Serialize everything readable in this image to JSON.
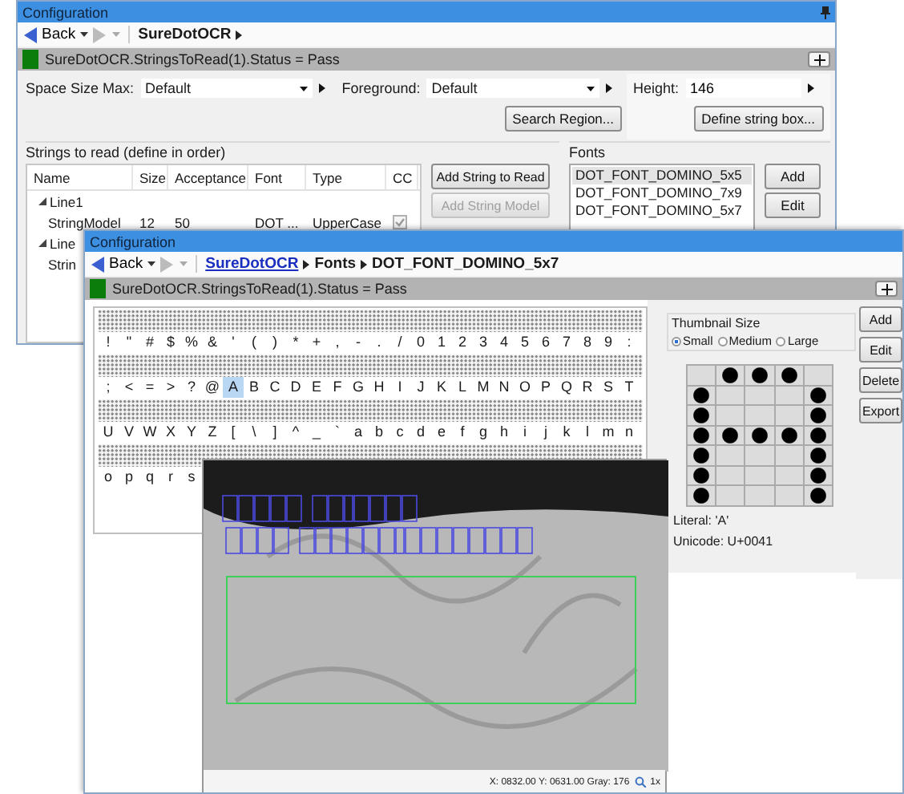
{
  "back_window": {
    "title": "Configuration",
    "nav": {
      "back": "Back",
      "crumbs": [
        {
          "label": "SureDotOCR",
          "link": false
        }
      ]
    },
    "status": {
      "text": "SureDotOCR.StringsToRead(1).Status = Pass",
      "passed": true
    },
    "fields": [
      {
        "label": "Space Size Max:",
        "value": "Default"
      },
      {
        "label": "Foreground:",
        "value": "Default"
      }
    ],
    "height": {
      "label": "Height:",
      "value": "146"
    },
    "search_button": "Search Region...",
    "define_button": "Define string box...",
    "strings_group": {
      "title": "Strings to read (define in order)",
      "columns": [
        "Name",
        "Size",
        "Acceptance",
        "Font",
        "Type",
        "CC"
      ],
      "rows": [
        {
          "name": "Line1",
          "expanded": true,
          "children": [
            {
              "name": "StringModel",
              "size": "12",
              "acceptance": "50",
              "font": "DOT ...",
              "type": "UpperCase",
              "cc": true
            }
          ]
        },
        {
          "name": "Line",
          "expanded": true,
          "children": [
            {
              "name": "Strin"
            }
          ]
        }
      ]
    },
    "string_buttons": [
      {
        "label": "Add String to Read",
        "disabled": false
      },
      {
        "label": "Add String Model",
        "disabled": true
      }
    ],
    "fonts_group": {
      "title": "Fonts",
      "items": [
        {
          "label": "DOT_FONT_DOMINO_5x5",
          "selected": true
        },
        {
          "label": "DOT_FONT_DOMINO_7x9",
          "selected": false
        },
        {
          "label": "DOT_FONT_DOMINO_5x7",
          "selected": false
        }
      ],
      "buttons": [
        "Add",
        "Edit"
      ]
    }
  },
  "front_window": {
    "title": "Configuration",
    "nav": {
      "back": "Back",
      "crumbs": [
        {
          "label": "SureDotOCR",
          "link": true
        },
        {
          "label": "Fonts",
          "link": false
        },
        {
          "label": "DOT_FONT_DOMINO_5x7",
          "link": false
        }
      ]
    },
    "status": {
      "text": "SureDotOCR.StringsToRead(1).Status = Pass",
      "passed": true
    },
    "glyph_rows": [
      [
        {
          "char": "!",
          "selected": false
        },
        {
          "char": "\"",
          "selected": false
        },
        {
          "char": "#",
          "selected": false
        },
        {
          "char": "$",
          "selected": false
        },
        {
          "char": "%",
          "selected": false
        },
        {
          "char": "&",
          "selected": false
        },
        {
          "char": "'",
          "selected": false
        },
        {
          "char": "(",
          "selected": false
        },
        {
          "char": ")",
          "selected": false
        },
        {
          "char": "*",
          "selected": false
        },
        {
          "char": "+",
          "selected": false
        },
        {
          "char": ",",
          "selected": false
        },
        {
          "char": "-",
          "selected": false
        },
        {
          "char": ".",
          "selected": false
        },
        {
          "char": "/",
          "selected": false
        },
        {
          "char": "0",
          "selected": false
        },
        {
          "char": "1",
          "selected": false
        },
        {
          "char": "2",
          "selected": false
        },
        {
          "char": "3",
          "selected": false
        },
        {
          "char": "4",
          "selected": false
        },
        {
          "char": "5",
          "selected": false
        },
        {
          "char": "6",
          "selected": false
        },
        {
          "char": "7",
          "selected": false
        },
        {
          "char": "8",
          "selected": false
        },
        {
          "char": "9",
          "selected": false
        },
        {
          "char": ":",
          "selected": false
        }
      ],
      [
        {
          "char": ";",
          "selected": false
        },
        {
          "char": "<",
          "selected": false
        },
        {
          "char": "=",
          "selected": false
        },
        {
          "char": ">",
          "selected": false
        },
        {
          "char": "?",
          "selected": false
        },
        {
          "char": "@",
          "selected": false
        },
        {
          "char": "A",
          "selected": true
        },
        {
          "char": "B",
          "selected": false
        },
        {
          "char": "C",
          "selected": false
        },
        {
          "char": "D",
          "selected": false
        },
        {
          "char": "E",
          "selected": false
        },
        {
          "char": "F",
          "selected": false
        },
        {
          "char": "G",
          "selected": false
        },
        {
          "char": "H",
          "selected": false
        },
        {
          "char": "I",
          "selected": false
        },
        {
          "char": "J",
          "selected": false
        },
        {
          "char": "K",
          "selected": false
        },
        {
          "char": "L",
          "selected": false
        },
        {
          "char": "M",
          "selected": false
        },
        {
          "char": "N",
          "selected": false
        },
        {
          "char": "O",
          "selected": false
        },
        {
          "char": "P",
          "selected": false
        },
        {
          "char": "Q",
          "selected": false
        },
        {
          "char": "R",
          "selected": false
        },
        {
          "char": "S",
          "selected": false
        },
        {
          "char": "T",
          "selected": false
        }
      ],
      [
        {
          "char": "U",
          "selected": false
        },
        {
          "char": "V",
          "selected": false
        },
        {
          "char": "W",
          "selected": false
        },
        {
          "char": "X",
          "selected": false
        },
        {
          "char": "Y",
          "selected": false
        },
        {
          "char": "Z",
          "selected": false
        },
        {
          "char": "[",
          "selected": false
        },
        {
          "char": "\\",
          "selected": false
        },
        {
          "char": "]",
          "selected": false
        },
        {
          "char": "^",
          "selected": false
        },
        {
          "char": "_",
          "selected": false
        },
        {
          "char": "`",
          "selected": false
        },
        {
          "char": "a",
          "selected": false
        },
        {
          "char": "b",
          "selected": false
        },
        {
          "char": "c",
          "selected": false
        },
        {
          "char": "d",
          "selected": false
        },
        {
          "char": "e",
          "selected": false
        },
        {
          "char": "f",
          "selected": false
        },
        {
          "char": "g",
          "selected": false
        },
        {
          "char": "h",
          "selected": false
        },
        {
          "char": "i",
          "selected": false
        },
        {
          "char": "j",
          "selected": false
        },
        {
          "char": "k",
          "selected": false
        },
        {
          "char": "l",
          "selected": false
        },
        {
          "char": "m",
          "selected": false
        },
        {
          "char": "n",
          "selected": false
        }
      ],
      [
        {
          "char": "o",
          "selected": false
        },
        {
          "char": "p",
          "selected": false
        },
        {
          "char": "q",
          "selected": false
        },
        {
          "char": "r",
          "selected": false
        },
        {
          "char": "s",
          "selected": false
        }
      ]
    ],
    "thumbnail": {
      "title": "Thumbnail Size",
      "sizes": [
        {
          "label": "Small",
          "selected": true
        },
        {
          "label": "Medium",
          "selected": false
        },
        {
          "label": "Large",
          "selected": false
        }
      ],
      "dots": [
        [
          false,
          true,
          true,
          true,
          false
        ],
        [
          true,
          false,
          false,
          false,
          true
        ],
        [
          true,
          false,
          false,
          false,
          true
        ],
        [
          true,
          true,
          true,
          true,
          true
        ],
        [
          true,
          false,
          false,
          false,
          true
        ],
        [
          true,
          false,
          false,
          false,
          true
        ],
        [
          true,
          false,
          false,
          false,
          true
        ]
      ]
    },
    "literal": "Literal: 'A'",
    "unicode": "Unicode: U+0041",
    "buttons": [
      "Add",
      "Edit",
      "Delete",
      "Export"
    ],
    "image_view": {
      "readout": "X: 0832.00 Y: 0631.00 Gray: 176",
      "zoom": "1x"
    }
  }
}
